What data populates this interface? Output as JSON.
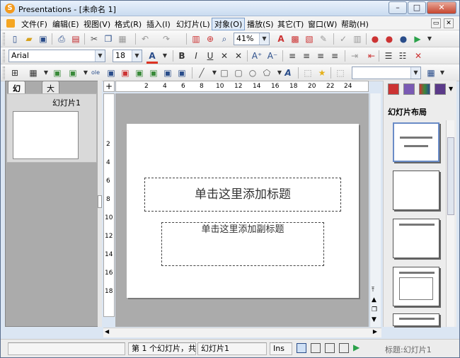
{
  "window": {
    "title": "Presentations - [未命名 1]",
    "app_icon": "S",
    "buttons": {
      "minimize": "–",
      "maximize": "□",
      "close": "✕"
    }
  },
  "menubar": {
    "items": [
      "文件(F)",
      "编辑(E)",
      "视图(V)",
      "格式(R)",
      "插入(I)",
      "幻灯片(L)",
      "对象(O)",
      "播放(S)",
      "其它(T)",
      "窗口(W)",
      "帮助(H)"
    ],
    "active_index": 6
  },
  "toolbar1": {
    "zoom": "41%"
  },
  "toolbar2": {
    "font": "Arial",
    "size": "18"
  },
  "left_panel": {
    "tabs": [
      "幻灯片",
      "大纲"
    ],
    "thumbnail_label": "幻灯片1"
  },
  "ruler": {
    "h_ticks": [
      "2",
      "4",
      "6",
      "8",
      "10",
      "12",
      "14",
      "16",
      "18",
      "20",
      "22",
      "24"
    ],
    "v_ticks": [
      "2",
      "4",
      "6",
      "8",
      "10",
      "12",
      "14",
      "16",
      "18"
    ]
  },
  "slide": {
    "title_placeholder": "单击这里添加标题",
    "subtitle_placeholder": "单击这里添加副标题"
  },
  "right_panel": {
    "heading": "幻灯片布局"
  },
  "statusbar": {
    "slide_info": "第 1 个幻灯片，共",
    "slide_name": "幻灯片1",
    "mode": "Ins",
    "watermark": "标题:幻灯片1"
  },
  "colors": {
    "accent_blue": "#2a4d8a",
    "canvas_gray": "#ababab",
    "title_bar": "#c9dbf0"
  }
}
